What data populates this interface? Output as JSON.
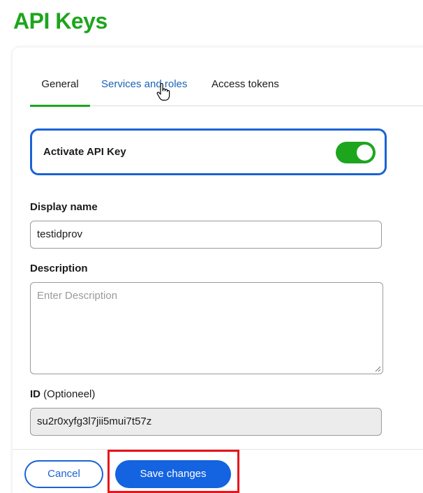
{
  "page": {
    "title": "API Keys"
  },
  "tabs": [
    {
      "label": "General",
      "active": true
    },
    {
      "label": "Services and roles",
      "active": false
    },
    {
      "label": "Access tokens",
      "active": false
    }
  ],
  "activate": {
    "label": "Activate API Key",
    "enabled": true
  },
  "fields": {
    "display_name": {
      "label": "Display name",
      "value": "testidprov"
    },
    "description": {
      "label": "Description",
      "placeholder": "Enter Description",
      "value": ""
    },
    "id": {
      "label": "ID",
      "optional_note": "(Optioneel)",
      "value": "su2r0xyfg3l7jii5mui7t57z"
    }
  },
  "footer": {
    "cancel_label": "Cancel",
    "save_label": "Save changes"
  },
  "colors": {
    "brand_green": "#1ea51e",
    "primary_blue": "#1463e0",
    "highlight_red": "#e8141c"
  }
}
